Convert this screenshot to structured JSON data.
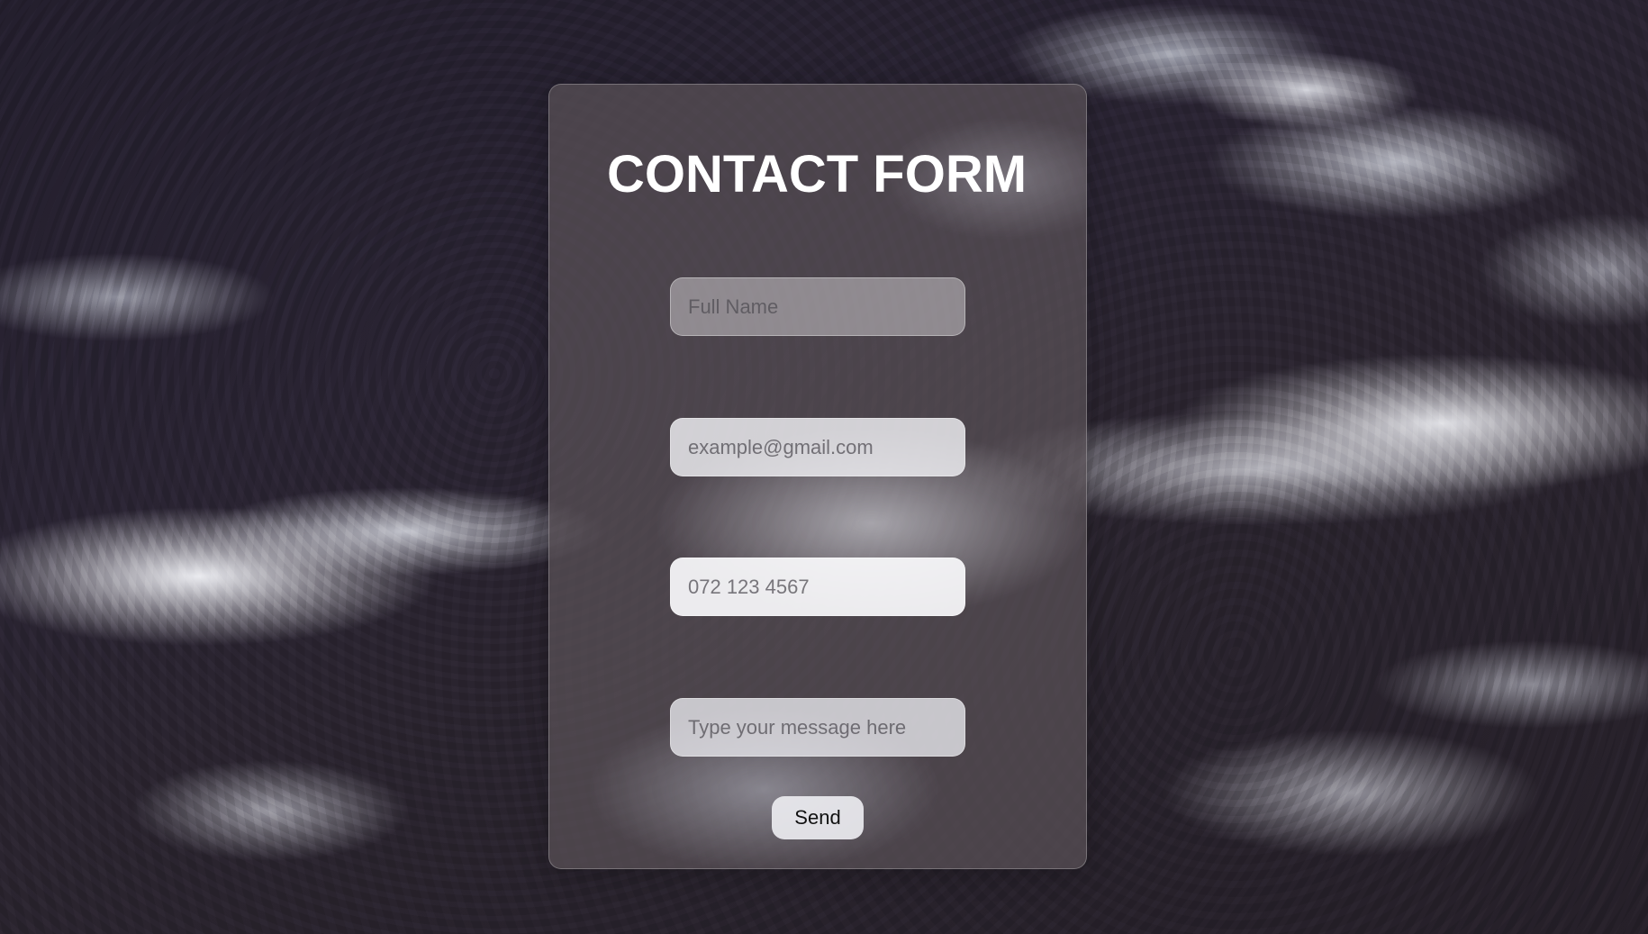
{
  "form": {
    "title": "CONTACT FORM",
    "fields": {
      "name_placeholder": "Full Name",
      "email_placeholder": "example@gmail.com",
      "phone_placeholder": "072 123 4567",
      "message_placeholder": "Type your message here"
    },
    "submit_label": "Send"
  },
  "background": {
    "description_colors": [
      "#241f2e",
      "#f0f2f8"
    ]
  }
}
